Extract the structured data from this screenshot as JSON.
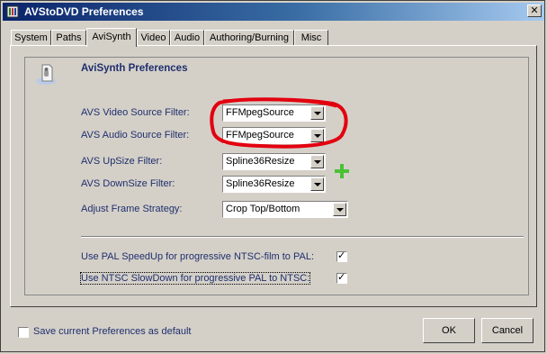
{
  "window": {
    "title": "AVStoDVD Preferences",
    "close": "✕"
  },
  "tabs": [
    "System",
    "Paths",
    "AviSynth",
    "Video",
    "Audio",
    "Authoring/Burning",
    "Misc"
  ],
  "active_tab": "AviSynth",
  "section": {
    "title": "AviSynth Preferences"
  },
  "fields": {
    "video_source": {
      "label": "AVS Video Source Filter:",
      "value": "FFMpegSource"
    },
    "audio_source": {
      "label": "AVS Audio Source Filter:",
      "value": "FFMpegSource"
    },
    "upsize": {
      "label": "AVS UpSize Filter:",
      "value": "Spline36Resize"
    },
    "downsize": {
      "label": "AVS DownSize Filter:",
      "value": "Spline36Resize"
    },
    "frame_strategy": {
      "label": "Adjust Frame Strategy:",
      "value": "Crop Top/Bottom"
    }
  },
  "options": {
    "pal_speedup": {
      "label": "Use PAL SpeedUp for progressive NTSC-film to PAL:",
      "checked": true
    },
    "ntsc_slowdown": {
      "label": "Use NTSC SlowDown for progressive PAL to NTSC:",
      "checked": true
    }
  },
  "footer": {
    "save_default": {
      "label": "Save current Preferences as default",
      "checked": false
    },
    "ok": "OK",
    "cancel": "Cancel"
  },
  "colors": {
    "label_text": "#1f2f6e",
    "highlight_circle": "#e3000f",
    "add_icon": "#49c234"
  },
  "icons": {
    "title": "app-icon",
    "header": "avisynth-icon",
    "add": "plus-icon",
    "dropdown": "chevron-down-icon"
  }
}
